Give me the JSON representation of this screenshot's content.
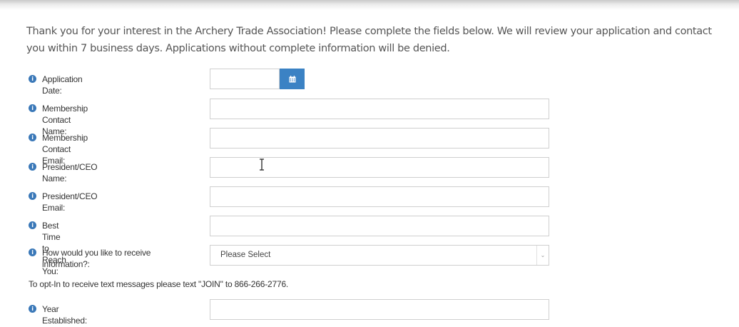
{
  "intro": {
    "text": "Thank you for your interest in the Archery Trade Association! Please complete the fields below. We will review your application and contact you within 7 business days. Applications without complete information will be denied."
  },
  "form": {
    "application_date_label": "Application Date:",
    "application_date_value": "",
    "membership_contact_name_label": "Membership Contact Name:",
    "membership_contact_name_value": "",
    "membership_contact_email_label": "Membership Contact Email:",
    "membership_contact_email_value": "",
    "president_ceo_name_label": "President/CEO Name:",
    "president_ceo_name_value": "",
    "president_ceo_email_label": "President/CEO Email:",
    "president_ceo_email_value": "",
    "best_time_label": "Best Time to Reach You:",
    "best_time_value": "",
    "receive_info_label": "How would you like to receive information?:",
    "receive_info_selected": "Please Select",
    "optin_text": "To opt-In to receive text messages please text \"JOIN\" to 866-266-2776.",
    "year_established_label": "Year Established:",
    "year_established_value": ""
  },
  "icons": {
    "info": "info-icon",
    "calendar": "calendar-icon",
    "dropdown": "chevron-down-icon",
    "cursor": "text-cursor-icon"
  },
  "colors": {
    "info_icon": "#3a78b8",
    "calendar_button": "#3b82c4",
    "field_border": "#cfcfcf"
  }
}
